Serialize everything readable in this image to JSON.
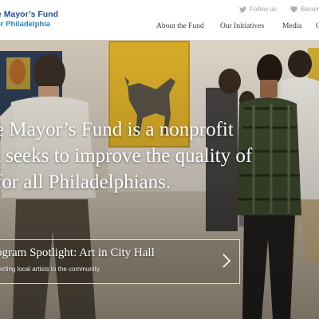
{
  "logo": {
    "line1": "e Mayor’s Fund",
    "line2": "or Philadelphia"
  },
  "social": {
    "follow_label": "Follow us",
    "follow_icon": "twitter-icon",
    "become_label": "Becom",
    "become_icon": "heart-icon"
  },
  "nav": {
    "items": [
      {
        "label": "About the Fund"
      },
      {
        "label": "Our Initiatives"
      },
      {
        "label": "Media"
      },
      {
        "label": "O"
      }
    ]
  },
  "hero": {
    "headline_lines": [
      "e Mayor’s Fund is a nonprofit",
      "t seeks to improve the quality of",
      "for all Philadelphians."
    ],
    "spotlight": {
      "title": "ogram Spotlight: Art in City Hall",
      "subtitle": "ecting local artists to the community.",
      "arrow_icon": "chevron-right-icon"
    }
  },
  "colors": {
    "logo_dark": "#24508f",
    "logo_light": "#2a84c6",
    "nav_text": "#3a3a3a",
    "social_text": "#9aa3ab"
  }
}
